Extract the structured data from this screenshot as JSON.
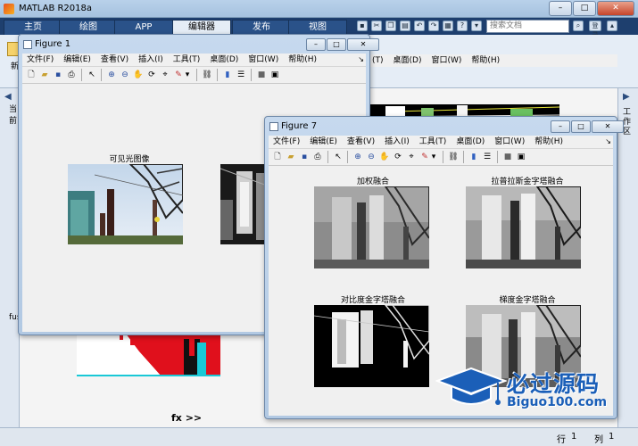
{
  "app": {
    "title": "MATLAB R2018a",
    "tabs": [
      "主页",
      "绘图",
      "APP",
      "编辑器",
      "发布",
      "视图"
    ],
    "active_tab": "编辑器",
    "search_placeholder": "搜索文档",
    "login_label": "登录",
    "left_panel_label": "当前",
    "left_bottom_label": "fus",
    "right_panel_label": "工作区",
    "ribbon_label": "新",
    "bottom_cmd": "fx >>",
    "status": {
      "row_label": "行",
      "row_value": "1",
      "col_label": "列",
      "col_value": "1"
    }
  },
  "menus": [
    "文件(F)",
    "编辑(E)",
    "查看(V)",
    "插入(I)",
    "工具(T)",
    "桌面(D)",
    "窗口(W)",
    "帮助(H)"
  ],
  "background_menus": [
    "(T)",
    "桌面(D)",
    "窗口(W)",
    "帮助(H)"
  ],
  "figure1": {
    "title": "Figure 1",
    "subplots": [
      {
        "title": "可见光图像"
      }
    ]
  },
  "figure7": {
    "title": "Figure 7",
    "subplots": [
      {
        "title": "加权融合"
      },
      {
        "title": "拉普拉斯金字塔融合"
      },
      {
        "title": "对比度金字塔融合"
      },
      {
        "title": "梯度金字塔融合"
      }
    ]
  },
  "watermark": {
    "cn": "必过源码",
    "en": "Biguo100.com"
  },
  "icons": {
    "new": "new-file-icon",
    "open": "open-folder-icon",
    "save": "save-icon",
    "print": "print-icon",
    "pointer": "pointer-icon",
    "zoom_in": "zoom-in-icon",
    "zoom_out": "zoom-out-icon",
    "pan": "pan-icon",
    "rotate": "rotate-icon",
    "datatip": "data-cursor-icon",
    "brush": "brush-icon",
    "link": "link-plot-icon",
    "colorbar": "colorbar-icon",
    "legend": "legend-icon",
    "hide": "hide-plot-tools-icon",
    "show": "show-plot-tools-icon"
  }
}
